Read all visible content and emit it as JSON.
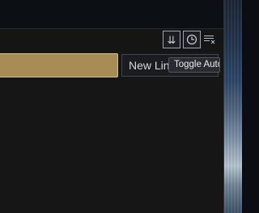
{
  "toolbar": {
    "scroll_icon": "double-chevron-down-icon",
    "clock_icon": "clock-icon",
    "clear_icon": "clear-lines-icon"
  },
  "input": {
    "value": "",
    "fill_color": "#a88c55"
  },
  "buttons": {
    "new_line_label": "New Lin"
  },
  "tooltip": {
    "text": "Toggle Autoscro"
  }
}
